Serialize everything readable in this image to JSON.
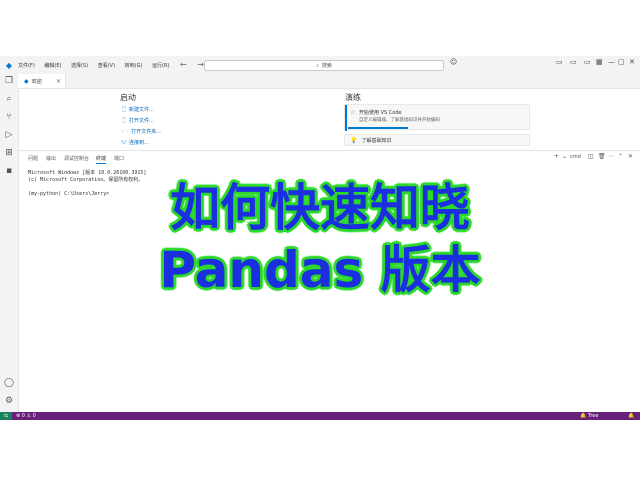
{
  "titlebar": {
    "menu": [
      "文件(F)",
      "编辑(E)",
      "选择(S)",
      "查看(V)",
      "转到(G)",
      "运行(R)"
    ],
    "search_label": "搜索",
    "window_controls": [
      "—",
      "▢",
      "✕"
    ]
  },
  "activity_icons": [
    "explorer-icon",
    "search-icon",
    "source-control-icon",
    "run-debug-icon",
    "extensions-icon",
    "terminal-icon",
    "account-icon",
    "settings-gear-icon"
  ],
  "tab": {
    "label": "欢迎",
    "close": "×"
  },
  "welcome": {
    "start_title": "启动",
    "start_items": [
      {
        "icon": "🗋",
        "label": "新建文件..."
      },
      {
        "icon": "🗋",
        "label": "打开文件..."
      },
      {
        "icon": "🗁",
        "label": "打开文件夹..."
      },
      {
        "icon": "⤲",
        "label": "连接到..."
      }
    ],
    "walkthroughs_title": "演练",
    "card1_title": "开始使用 VS Code",
    "card1_desc": "自定义编辑器、了解基础知识并开始编码",
    "card2_title": "了解基础知识"
  },
  "panel": {
    "tabs": [
      "问题",
      "输出",
      "调试控制台",
      "终端",
      "端口"
    ],
    "active_tab": "终端",
    "terminal_name": "cmd"
  },
  "terminal": {
    "lines": [
      "Microsoft Windows [版本 10.0.26100.3915]",
      "(c) Microsoft Corporation。保留所有权利。",
      "",
      "(my-python) C:\\Users\\Jerry>"
    ]
  },
  "overlay": {
    "line1": "如何快速知晓",
    "line2": "Pandas 版本"
  },
  "statusbar": {
    "problems": "⊗ 0 ⚠ 0",
    "right": "Tree"
  }
}
